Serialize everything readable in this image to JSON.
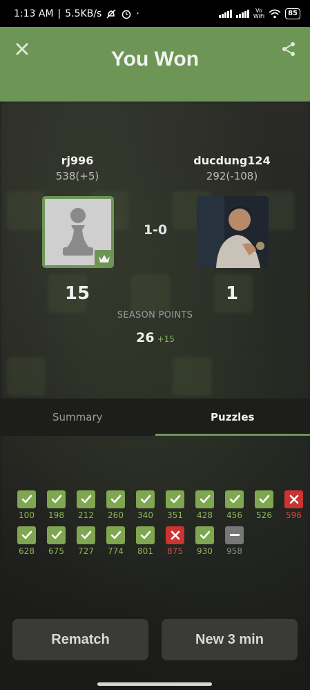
{
  "status_bar": {
    "time": "1:13 AM",
    "speed": "5.5KB/s",
    "dot": "·",
    "vowifi_top": "Vo",
    "vowifi_bottom": "WiFi",
    "battery": "85"
  },
  "header": {
    "title": "You Won",
    "color": "#6d9556"
  },
  "players": {
    "left": {
      "name": "rj996",
      "rating": "538(+5)",
      "season_points": "15"
    },
    "right": {
      "name": "ducdung124",
      "rating": "292(-108)",
      "season_points": "1"
    }
  },
  "result": "1-0",
  "season": {
    "label": "SEASON POINTS",
    "total": "26",
    "delta": "+15"
  },
  "tabs": [
    {
      "label": "Summary",
      "active": false
    },
    {
      "label": "Puzzles",
      "active": true
    }
  ],
  "puzzles": {
    "row1": [
      {
        "num": "100",
        "status": "ok"
      },
      {
        "num": "198",
        "status": "ok"
      },
      {
        "num": "212",
        "status": "ok"
      },
      {
        "num": "260",
        "status": "ok"
      },
      {
        "num": "340",
        "status": "ok"
      },
      {
        "num": "351",
        "status": "ok"
      },
      {
        "num": "428",
        "status": "ok"
      },
      {
        "num": "456",
        "status": "ok"
      },
      {
        "num": "526",
        "status": "ok"
      },
      {
        "num": "596",
        "status": "bad"
      }
    ],
    "row2": [
      {
        "num": "628",
        "status": "ok"
      },
      {
        "num": "675",
        "status": "ok"
      },
      {
        "num": "727",
        "status": "ok"
      },
      {
        "num": "774",
        "status": "ok"
      },
      {
        "num": "801",
        "status": "ok"
      },
      {
        "num": "875",
        "status": "bad"
      },
      {
        "num": "930",
        "status": "ok"
      },
      {
        "num": "958",
        "status": "skip"
      }
    ]
  },
  "buttons": {
    "rematch": "Rematch",
    "new_game": "New 3 min"
  },
  "colors": {
    "success": "#7fa650",
    "fail": "#ca3431",
    "skip": "#777777"
  }
}
